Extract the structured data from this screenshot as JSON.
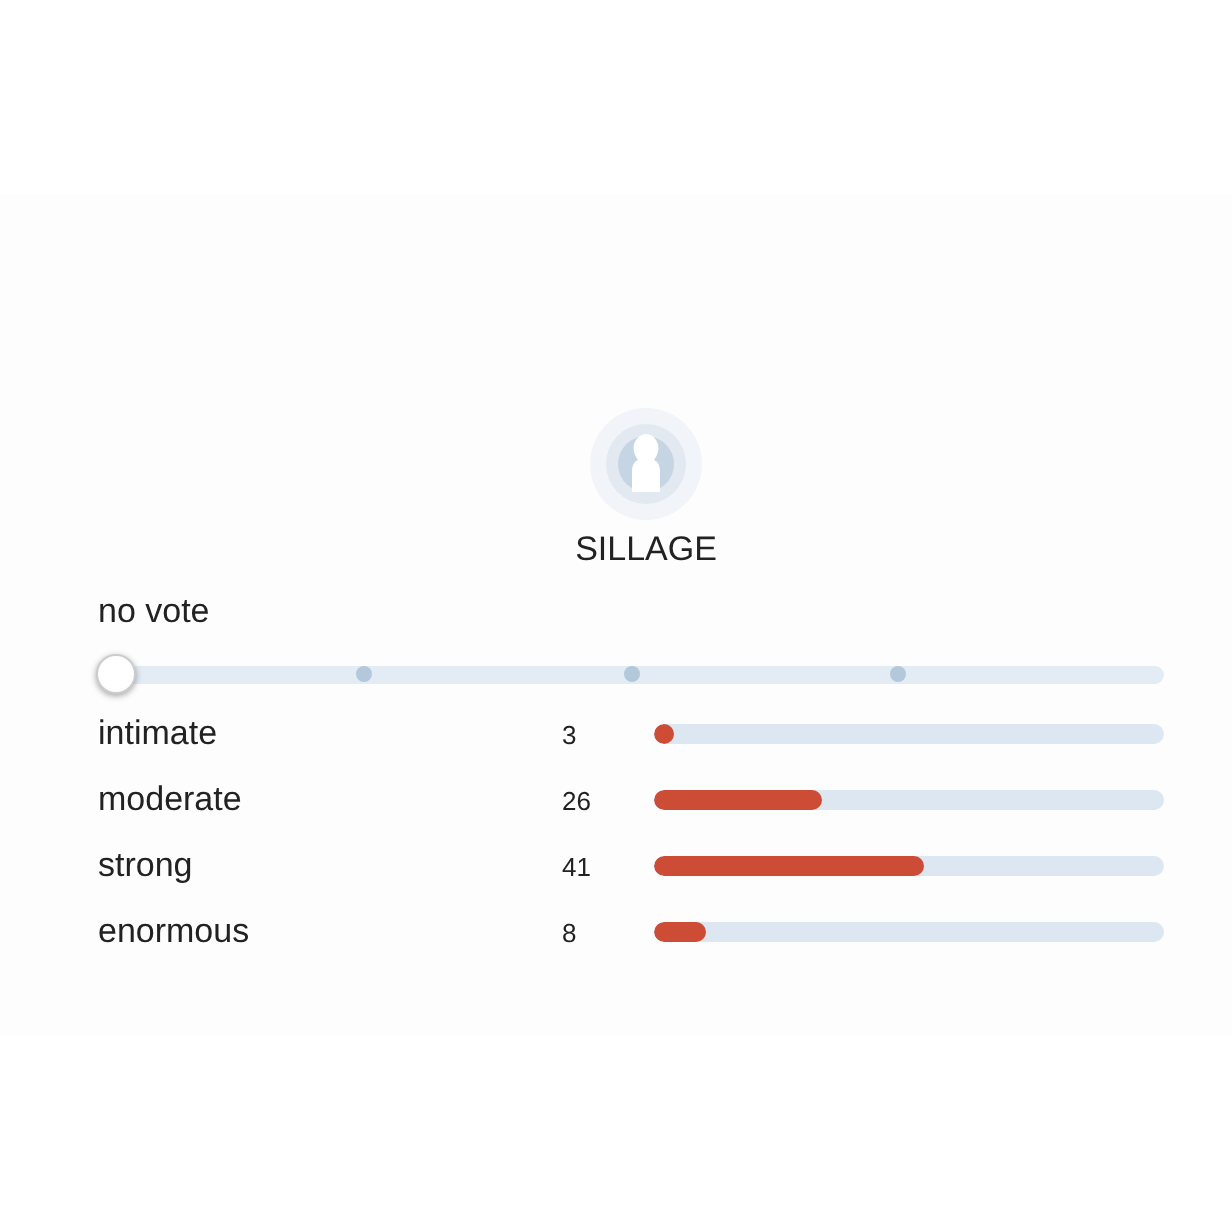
{
  "title": "SILLAGE",
  "vote": {
    "label": "no vote",
    "level": 0
  },
  "rows": [
    {
      "name": "intimate",
      "count": "3",
      "level": 0.04
    },
    {
      "name": "moderate",
      "count": "26",
      "level": 0.33
    },
    {
      "name": "strong",
      "count": "41",
      "level": 0.53
    },
    {
      "name": "enormous",
      "count": "8",
      "level": 0.1
    }
  ]
}
